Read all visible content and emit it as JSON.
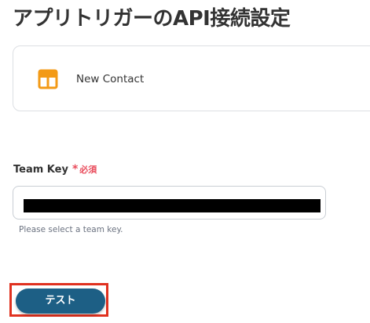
{
  "page": {
    "title": "アプリトリガーのAPI接続設定"
  },
  "trigger": {
    "app_icon": "orange-layout-grid-icon",
    "name": "New Contact"
  },
  "team_key_field": {
    "label": "Team Key",
    "required_mark": "*",
    "required_text": "必須",
    "value": "",
    "value_redacted": true,
    "help_text": "Please select a team key."
  },
  "actions": {
    "test_button_label": "テスト"
  },
  "colors": {
    "title_text": "#333333",
    "app_icon_orange": "#f39a16",
    "required_red": "#e94b5b",
    "button_bg": "#1d5f85",
    "highlight_border": "#e0311f"
  }
}
